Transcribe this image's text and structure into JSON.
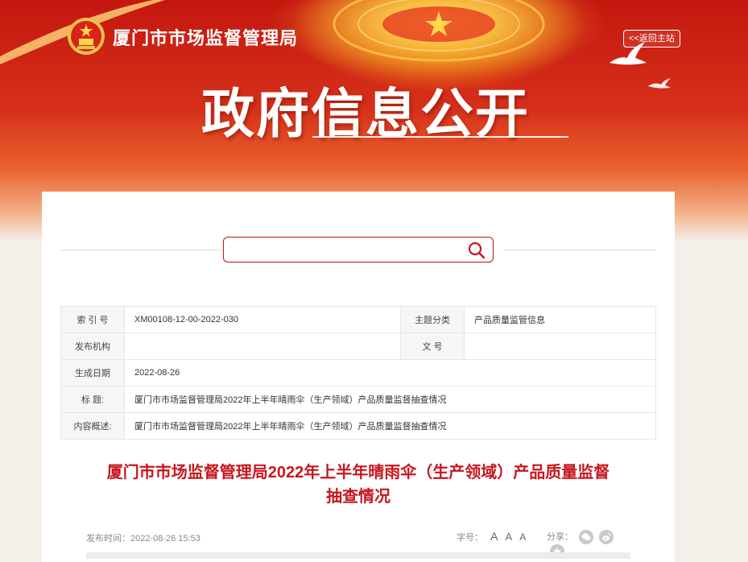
{
  "header": {
    "site_name": "厦门市市场监督管理局",
    "return_link": "<<返回主站",
    "banner_title": "政府信息公开"
  },
  "search": {
    "value": "",
    "placeholder": ""
  },
  "meta_table": {
    "rows": [
      {
        "label": "索 引 号",
        "value": "XM00108-12-00-2022-030",
        "label2": "主题分类",
        "value2": "产品质量监管信息"
      },
      {
        "label": "发布机构",
        "value": "",
        "label2": "文      号",
        "value2": ""
      },
      {
        "label": "生成日期",
        "value": "2022-08-26"
      },
      {
        "label": "标      题:",
        "value": "厦门市市场监督管理局2022年上半年晴雨伞（生产领域）产品质量监督抽查情况"
      },
      {
        "label": "内容概述:",
        "value": "厦门市市场监督管理局2022年上半年晴雨伞（生产领域）产品质量监督抽查情况"
      }
    ]
  },
  "article": {
    "title_line1": "厦门市市场监督管理局2022年上半年晴雨伞（生产领域）产品质量监督",
    "title_line2": "抽查情况",
    "publish_label": "发布时间：",
    "publish_time": "2022-08-26 15:53",
    "font_size_label": "字号：",
    "font_large": "A",
    "font_medium": "A",
    "font_small": "A",
    "share_label": "分享："
  },
  "colors": {
    "accent": "#c8161d",
    "banner_red": "#d6301a"
  },
  "icons": [
    "emblem-icon",
    "dove-icon",
    "search-icon",
    "wechat-icon",
    "weibo-icon",
    "favorite-icon"
  ]
}
